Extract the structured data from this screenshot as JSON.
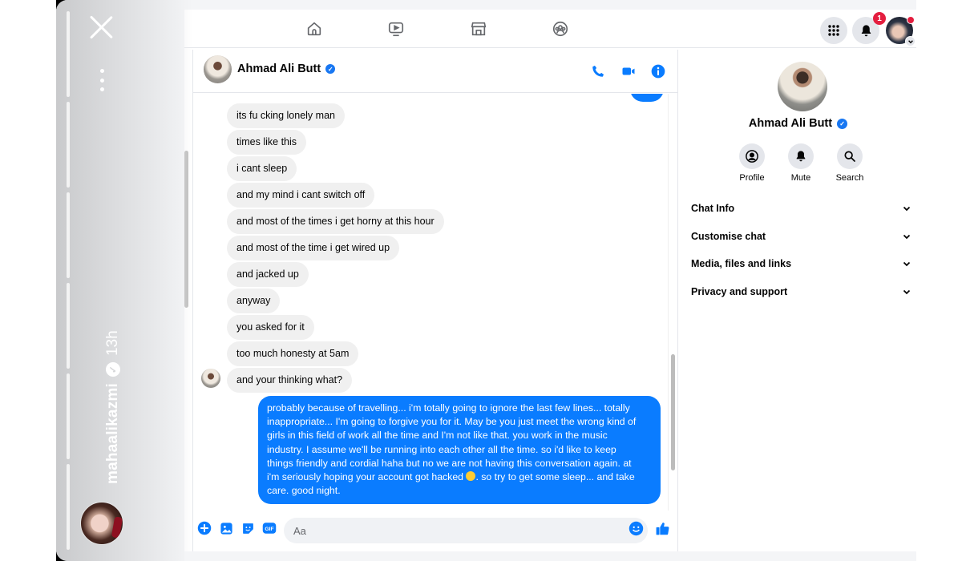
{
  "story": {
    "username": "mahaalikazmi",
    "verified_glyph": "✓",
    "time_ago": "13h",
    "progress_segments": 6,
    "close_icon": "close-icon",
    "menu_icon": "more-vertical-icon"
  },
  "topbar": {
    "nav": [
      {
        "name": "home",
        "icon": "home-icon"
      },
      {
        "name": "watch",
        "icon": "video-icon"
      },
      {
        "name": "marketplace",
        "icon": "store-icon"
      },
      {
        "name": "groups",
        "icon": "groups-icon"
      }
    ],
    "menu_icon": "grid-menu-icon",
    "notifications_icon": "bell-icon",
    "notification_count": "1",
    "account_icon": "account-avatar"
  },
  "chat": {
    "contact_name": "Ahmad Ali Butt",
    "verified": true,
    "header_actions": [
      "phone-icon",
      "video-call-icon",
      "info-icon"
    ],
    "incoming_messages": [
      "its fu cking lonely man",
      "times like this",
      "i cant sleep",
      "and my mind i cant switch off",
      "and most of the times i get horny at this hour",
      "and most of the time i get wired up",
      "and jacked up",
      "anyway",
      "you asked for it",
      "too much honesty at 5am",
      "and your thinking what?"
    ],
    "outgoing_message": {
      "lines": [
        "probably because of travelling... i'm totally going to ignore the last few lines... totally",
        "inappropriate... I'm going to forgive you for it. May be you just meet the wrong kind of",
        "girls in this field of work all the time and I'm not like that. you work in the music",
        "industry. I assume we'll be running into each other all the time. so i'd like to keep",
        "things friendly and cordial haha but no we are not having this conversation again. at",
        "i'm seriously hoping your account got hacked",
        ". so try to get some sleep... and take",
        "care. good night."
      ],
      "emoji": "😛"
    },
    "composer": {
      "placeholder": "Aa",
      "value": "",
      "icons": [
        "plus-icon",
        "photo-icon",
        "sticker-icon",
        "gif-icon",
        "emoji-icon",
        "thumbs-up-icon"
      ],
      "gif_label": "GIF"
    }
  },
  "info_panel": {
    "name": "Ahmad Ali Butt",
    "actions": [
      {
        "label": "Profile",
        "icon": "profile-icon"
      },
      {
        "label": "Mute",
        "icon": "bell-icon"
      },
      {
        "label": "Search",
        "icon": "search-icon"
      }
    ],
    "sections": [
      {
        "label": "Chat Info"
      },
      {
        "label": "Customise chat"
      },
      {
        "label": "Media, files and links"
      },
      {
        "label": "Privacy and support"
      }
    ]
  },
  "colors": {
    "accent": "#0a7cff",
    "fb_blue": "#1877f2",
    "badge_red": "#e41e3f",
    "incoming_bubble": "#f0f0f0"
  }
}
